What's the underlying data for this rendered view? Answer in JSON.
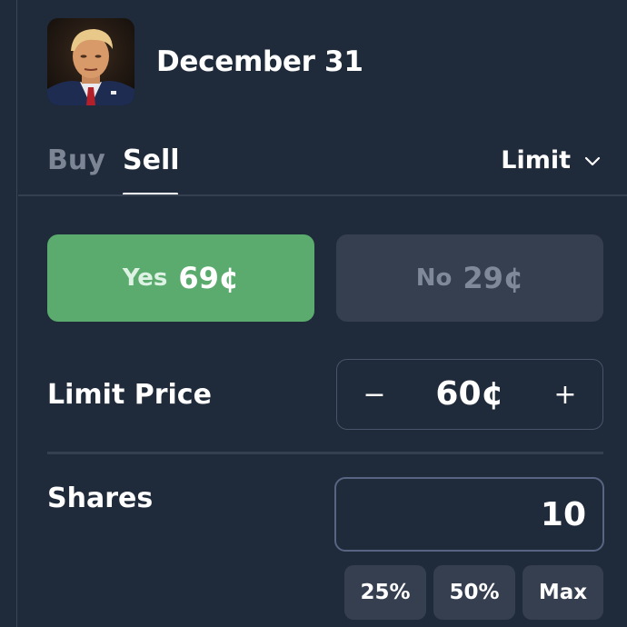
{
  "market": {
    "title": "December 31",
    "thumbnail_icon": "portrait-avatar"
  },
  "tabs": {
    "buy_label": "Buy",
    "sell_label": "Sell",
    "active": "Sell"
  },
  "order_type": {
    "label": "Limit",
    "icon": "chevron-down-icon"
  },
  "outcomes": {
    "yes": {
      "name": "Yes",
      "price": "69¢",
      "selected": true,
      "color": "#5bab6e"
    },
    "no": {
      "name": "No",
      "price": "29¢",
      "selected": false,
      "color": "#353f50"
    }
  },
  "limit_price": {
    "label": "Limit Price",
    "decrement": "−",
    "value": "60¢",
    "increment": "+"
  },
  "shares": {
    "label": "Shares",
    "value": "10"
  },
  "quick_amounts": {
    "p25": "25%",
    "p50": "50%",
    "max": "Max"
  },
  "colors": {
    "background": "#1f2a3a",
    "accent_yes": "#5bab6e",
    "muted_text": "#7c8593"
  }
}
